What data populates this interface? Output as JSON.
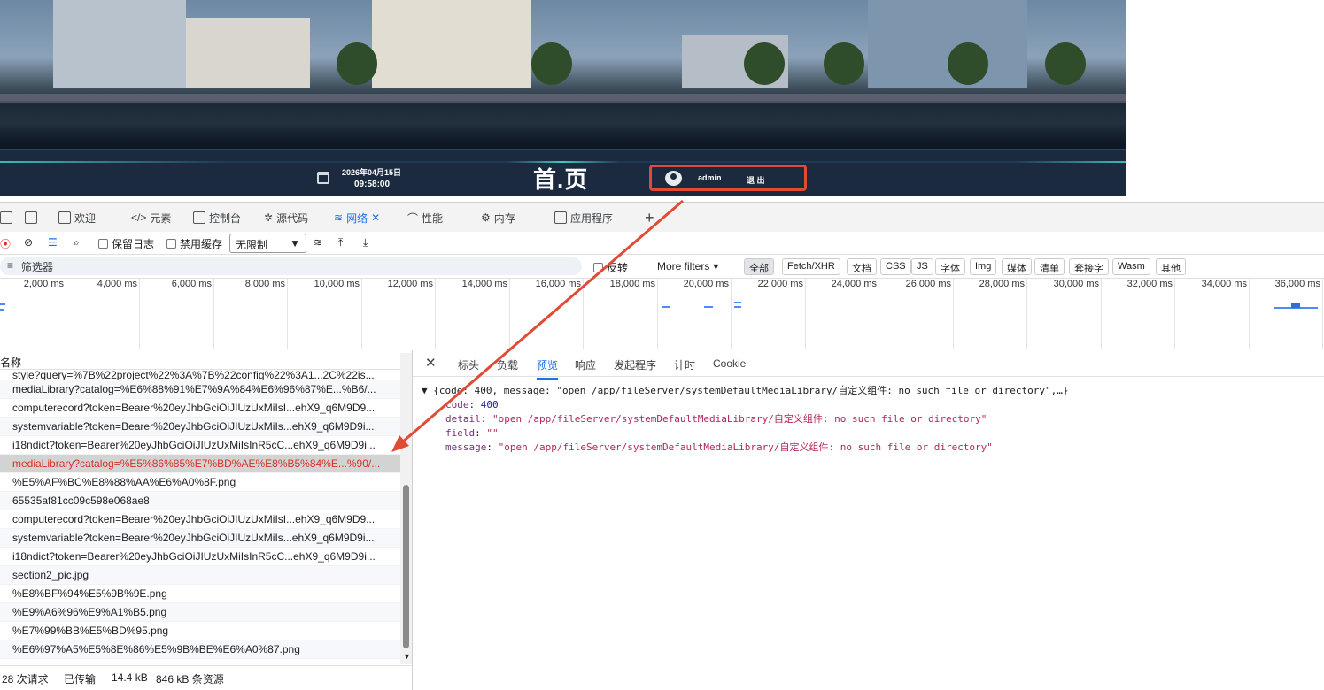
{
  "header": {
    "date": "2026年04月15日",
    "time": "09:58:00",
    "title": "首.页",
    "username": "admin",
    "logout": "退 出"
  },
  "devtools": {
    "tabs": [
      "欢迎",
      "元素",
      "控制台",
      "源代码",
      "网络",
      "性能",
      "内存",
      "应用程序"
    ],
    "toolbar": {
      "preserve_log": "保留日志",
      "disable_cache": "禁用缓存",
      "throttle": "无限制"
    },
    "filter": {
      "placeholder": "筛选器",
      "invert": "反转",
      "more_filters": "More filters"
    },
    "filter_types": [
      "全部",
      "Fetch/XHR",
      "文档",
      "CSS",
      "JS",
      "字体",
      "Img",
      "媒体",
      "清单",
      "套接字",
      "Wasm",
      "其他"
    ],
    "timeline_ticks": [
      "2,000 ms",
      "4,000 ms",
      "6,000 ms",
      "8,000 ms",
      "10,000 ms",
      "12,000 ms",
      "14,000 ms",
      "16,000 ms",
      "18,000 ms",
      "20,000 ms",
      "22,000 ms",
      "24,000 ms",
      "26,000 ms",
      "28,000 ms",
      "30,000 ms",
      "32,000 ms",
      "34,000 ms",
      "36,000 ms"
    ],
    "name_header": "名称",
    "requests": [
      "style?query=%7B%22project%22%3A%7B%22config%22%3A1...2C%22is...",
      "mediaLibrary?catalog=%E6%88%91%E7%9A%84%E6%96%87%E...%B6/...",
      "computerecord?token=Bearer%20eyJhbGciOiJIUzUxMiIsI...ehX9_q6M9D9...",
      "systemvariable?token=Bearer%20eyJhbGciOiJIUzUxMiIs...ehX9_q6M9D9i...",
      "i18ndict?token=Bearer%20eyJhbGciOiJIUzUxMiIsInR5cC...ehX9_q6M9D9i...",
      "mediaLibrary?catalog=%E5%86%85%E7%BD%AE%E8%B5%84%E...%90/...",
      "%E5%AF%BC%E8%88%AA%E6%A0%8F.png",
      "65535af81cc09c598e068ae8",
      "computerecord?token=Bearer%20eyJhbGciOiJIUzUxMiIsI...ehX9_q6M9D9...",
      "systemvariable?token=Bearer%20eyJhbGciOiJIUzUxMiIs...ehX9_q6M9D9i...",
      "i18ndict?token=Bearer%20eyJhbGciOiJIUzUxMiIsInR5cC...ehX9_q6M9D9i...",
      "section2_pic.jpg",
      "%E8%BF%94%E5%9B%9E.png",
      "%E9%A6%96%E9%A1%B5.png",
      "%E7%99%BB%E5%BD%95.png",
      "%E6%97%A5%E5%8E%86%E5%9B%BE%E6%A0%87.png"
    ],
    "status": {
      "requests": "28 次请求",
      "transferred": "已传输",
      "size": "14.4 kB",
      "resources": "846 kB 条资源"
    },
    "detail_tabs": [
      "标头",
      "负载",
      "预览",
      "响应",
      "发起程序",
      "计时",
      "Cookie"
    ],
    "preview": {
      "summary": "▼ {code: 400, message: \"open /app/fileServer/systemDefaultMediaLibrary/自定义组件: no such file or directory\",…}",
      "code_key": "code",
      "code_val": "400",
      "detail_key": "detail",
      "detail_val": "\"open /app/fileServer/systemDefaultMediaLibrary/自定义组件: no such file or directory\"",
      "field_key": "field",
      "field_val": "\"\"",
      "message_key": "message",
      "message_val": "\"open /app/fileServer/systemDefaultMediaLibrary/自定义组件: no such file or directory\""
    }
  }
}
